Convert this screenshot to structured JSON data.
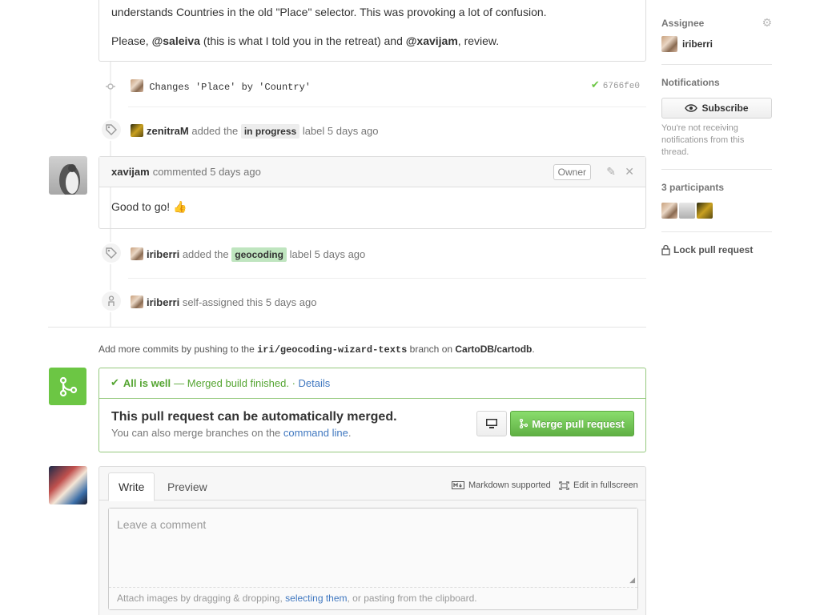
{
  "top_comment": {
    "line1": "understands Countries in the old \"Place\" selector. This was provoking a lot of confusion.",
    "line2_pre": "Please, ",
    "mention1": "@saleiva",
    "line2_mid": " (this is what I told you in the retreat) and ",
    "mention2": "@xavijam",
    "line2_post": ", review."
  },
  "commit": {
    "message": "Changes 'Place' by 'Country'",
    "sha": "6766fe0"
  },
  "events": [
    {
      "user": "zenitraM",
      "action": "added the",
      "label": "in progress",
      "label_color": "#ededed",
      "suffix": "label 5 days ago"
    },
    {
      "user": "iriberri",
      "action": "added the",
      "label": "geocoding",
      "label_color": "#bfe5bf",
      "suffix": "label 5 days ago"
    },
    {
      "user": "iriberri",
      "action": "self-assigned this 5 days ago"
    }
  ],
  "comment": {
    "author": "xavijam",
    "meta": "commented 5 days ago",
    "owner_tag": "Owner",
    "body": "Good to go! 👍"
  },
  "push_hint": {
    "pre": "Add more commits by pushing to the ",
    "branch": "iri/geocoding-wizard-texts",
    "mid": " branch on ",
    "repo": "CartoDB/cartodb",
    "post": "."
  },
  "merge": {
    "status_bold": "All is well",
    "status_text": " — Merged build finished. · ",
    "details": "Details",
    "title": "This pull request can be automatically merged.",
    "sub_pre": "You can also merge branches on the ",
    "sub_link": "command line",
    "sub_post": ".",
    "button": "Merge pull request",
    "accent": "#6cc644"
  },
  "new_comment": {
    "tab_write": "Write",
    "tab_preview": "Preview",
    "markdown": "Markdown supported",
    "fullscreen": "Edit in fullscreen",
    "placeholder": "Leave a comment",
    "drop_pre": "Attach images by dragging & dropping, ",
    "drop_link": "selecting them",
    "drop_post": ", or pasting from the clipboard."
  },
  "sidebar": {
    "assignee_title": "Assignee",
    "assignee": "iriberri",
    "notifications_title": "Notifications",
    "subscribe": "Subscribe",
    "not_receiving": "You're not receiving notifications from this thread.",
    "participants_title": "3 participants",
    "lock": "Lock pull request"
  }
}
